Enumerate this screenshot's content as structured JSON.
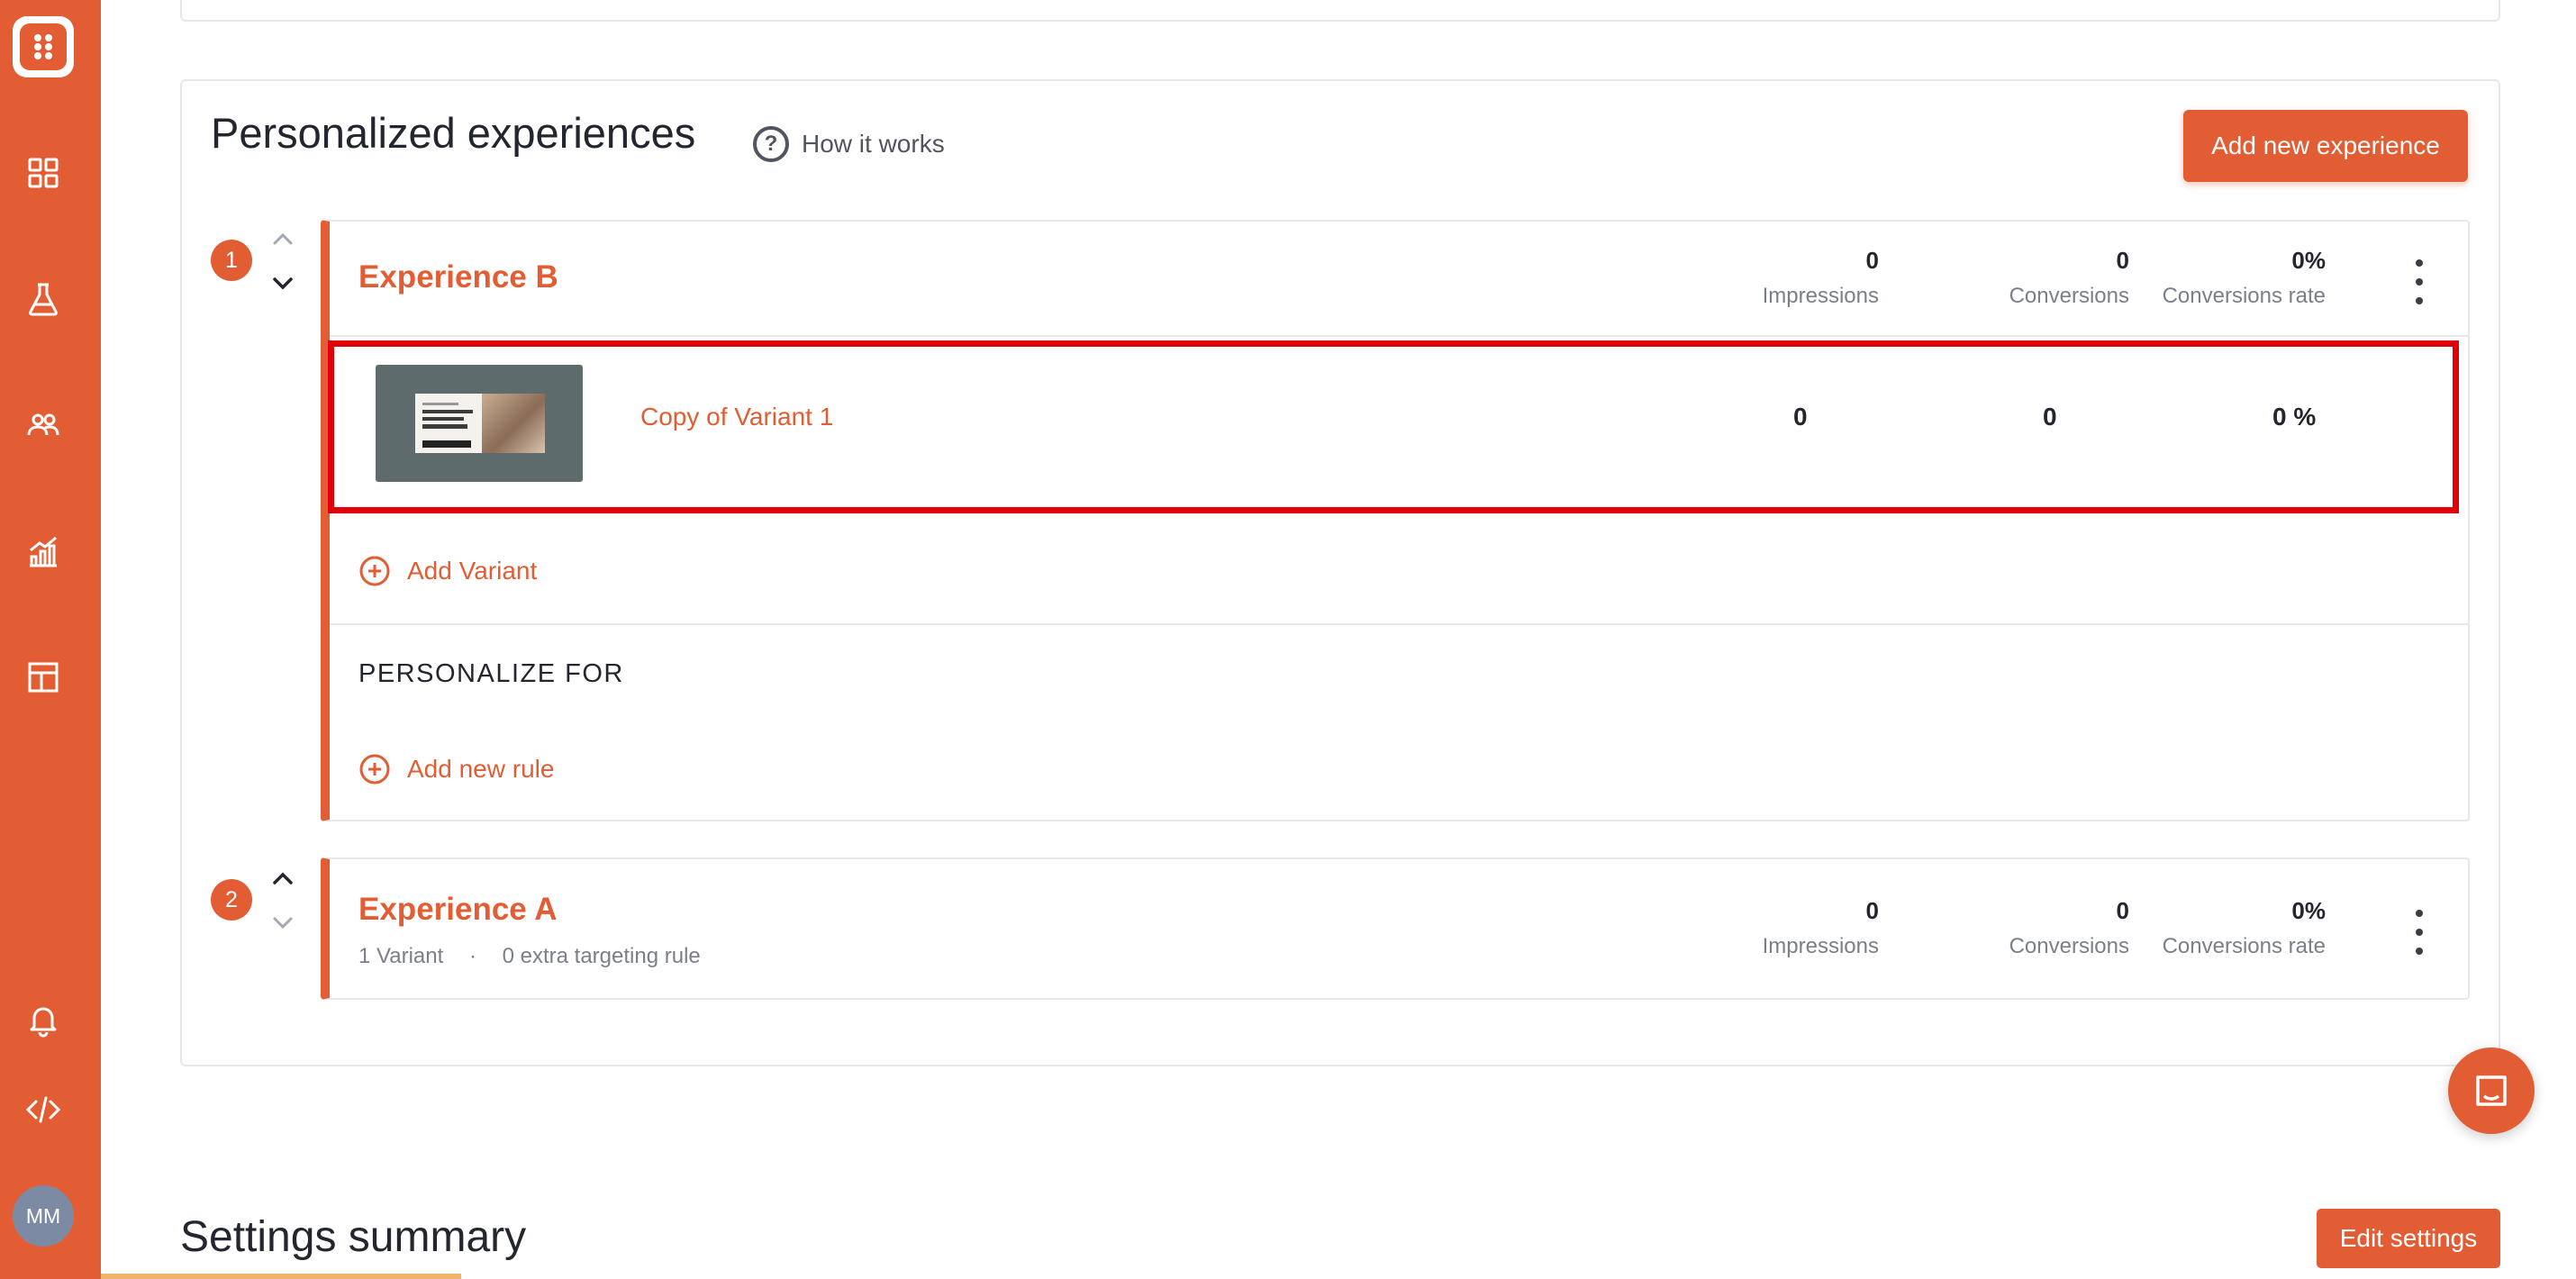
{
  "sidebar": {
    "items": [
      {
        "icon": "dashboard-icon"
      },
      {
        "icon": "flask-icon"
      },
      {
        "icon": "users-icon"
      },
      {
        "icon": "analytics-icon"
      },
      {
        "icon": "layout-icon"
      }
    ],
    "bottom": [
      {
        "icon": "bell-icon"
      },
      {
        "icon": "code-icon"
      }
    ],
    "avatar_initials": "MM"
  },
  "section": {
    "title": "Personalized experiences",
    "how_it_works": "How it works",
    "add_button": "Add new experience"
  },
  "experiences": [
    {
      "index": "1",
      "name": "Experience B",
      "impressions": "0",
      "conversions": "0",
      "rate": "0%",
      "impressions_label": "Impressions",
      "conversions_label": "Conversions",
      "rate_label": "Conversions rate",
      "variants": [
        {
          "name": "Copy of Variant 1",
          "impressions": "0",
          "conversions": "0",
          "rate": "0 %"
        }
      ],
      "add_variant": "Add Variant",
      "personalize_heading": "PERSONALIZE FOR",
      "add_rule": "Add new rule"
    },
    {
      "index": "2",
      "name": "Experience A",
      "variant_count": "1 Variant",
      "separator": "·",
      "rules": "0 extra targeting rule",
      "impressions": "0",
      "conversions": "0",
      "rate": "0%",
      "impressions_label": "Impressions",
      "conversions_label": "Conversions",
      "rate_label": "Conversions rate"
    }
  ],
  "settings": {
    "title": "Settings summary",
    "edit_button": "Edit settings"
  },
  "colors": {
    "accent": "#e25d33",
    "highlight": "#e00009"
  }
}
